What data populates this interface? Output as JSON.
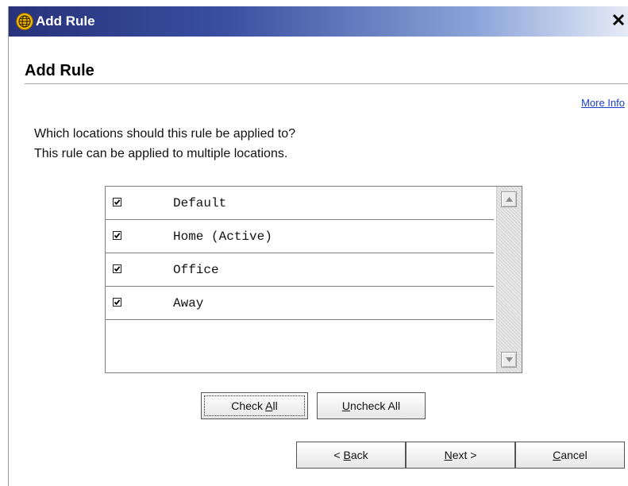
{
  "window": {
    "title": "Add Rule",
    "close_glyph": "✕"
  },
  "header": {
    "heading": "Add Rule",
    "more_info_link": "More Info"
  },
  "prompt": {
    "line1": "Which locations should this rule be applied to?",
    "line2": "This rule can be applied to multiple locations."
  },
  "locations": [
    {
      "label": "Default",
      "checked": true
    },
    {
      "label": "Home (Active)",
      "checked": true
    },
    {
      "label": "Office",
      "checked": true
    },
    {
      "label": "Away",
      "checked": true
    }
  ],
  "buttons": {
    "check_all": {
      "pre": "Check ",
      "acc": "A",
      "post": "ll"
    },
    "uncheck_all": {
      "pre": "",
      "acc": "U",
      "post": "ncheck All"
    },
    "back": {
      "pre": "< ",
      "acc": "B",
      "post": "ack"
    },
    "next": {
      "pre": "",
      "acc": "N",
      "post": "ext >"
    },
    "cancel": {
      "pre": "",
      "acc": "C",
      "post": "ancel"
    }
  },
  "icons": {
    "title_icon": "globe-icon",
    "scroll_up": "scroll-up-arrow-icon",
    "scroll_down": "scroll-down-arrow-icon"
  },
  "colors": {
    "titlebar_dark": "#27327a",
    "link": "#1a3ec8",
    "globe": "#f2b705"
  }
}
